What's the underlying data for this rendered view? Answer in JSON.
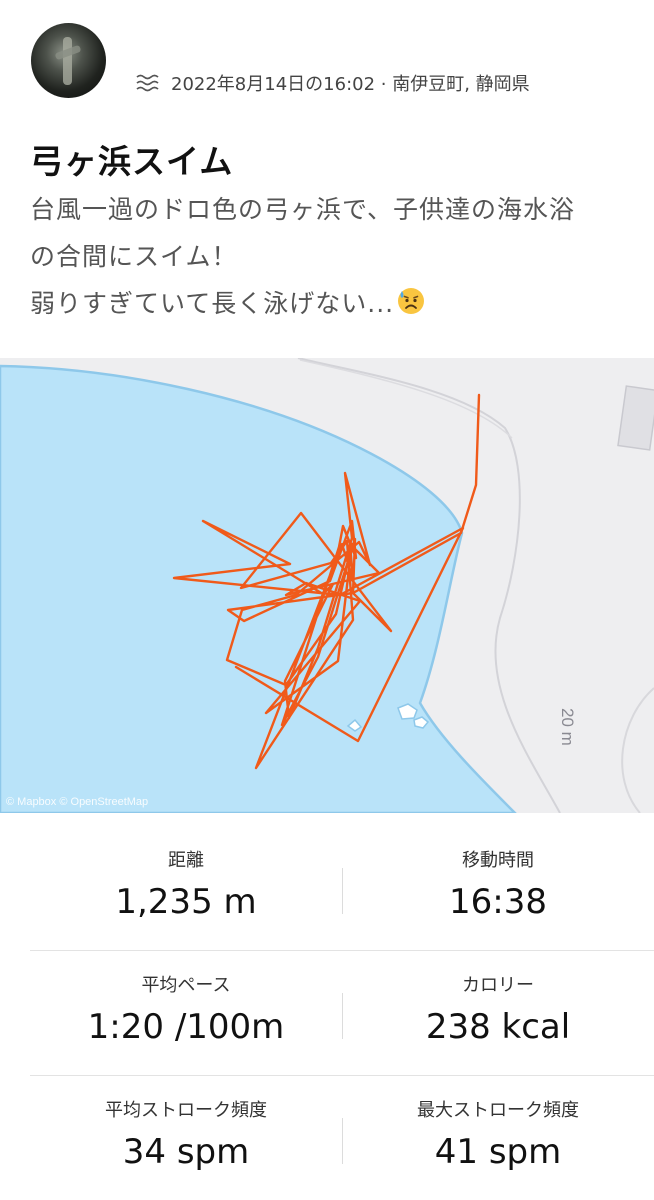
{
  "post": {
    "location_line": "2022年8月14日の16:02 · 南伊豆町, 静岡県",
    "activity_icon": "swim-waves-icon",
    "title": "弓ヶ浜スイム",
    "description_lines": [
      "台風一過のドロ色の弓ヶ浜で、子供達の海水浴",
      "の合間にスイム！",
      "弱りすぎていて長く泳げない..."
    ],
    "emoji": "anxious-sweat-face-emoji"
  },
  "map": {
    "attribution": "© Mapbox © OpenStreetMap",
    "contour_label": "20 m",
    "water_color": "#b9e3f9",
    "route_color": "#f05a1a"
  },
  "stats": {
    "distance": {
      "label": "距離",
      "value": "1,235 m"
    },
    "moving_time": {
      "label": "移動時間",
      "value": "16:38"
    },
    "avg_pace": {
      "label": "平均ペース",
      "value": "1:20 /100m"
    },
    "calories": {
      "label": "カロリー",
      "value": "238 kcal"
    },
    "avg_stroke_rate": {
      "label": "平均ストローク頻度",
      "value": "34 spm"
    },
    "max_stroke_rate": {
      "label": "最大ストローク頻度",
      "value": "41 spm"
    }
  }
}
